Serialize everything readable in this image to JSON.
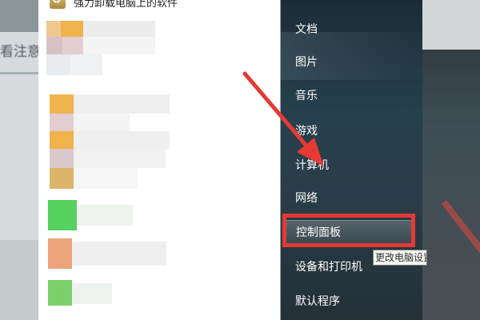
{
  "start_menu": {
    "left_pane": {
      "top_item_label": "强力卸载电脑上的软件"
    },
    "right_pane": {
      "items": [
        {
          "label": "文档"
        },
        {
          "label": "图片"
        },
        {
          "label": "音乐"
        },
        {
          "label": "游戏"
        },
        {
          "label": "计算机"
        },
        {
          "label": "网络"
        },
        {
          "label": "控制面板"
        },
        {
          "label": "设备和打印机"
        },
        {
          "label": "默认程序"
        }
      ],
      "highlighted_item": "控制面板"
    },
    "tooltip_text": "更改电脑设置"
  },
  "background": {
    "left_text": "看注意"
  },
  "annotation": {
    "highlight_color": "#e53a34",
    "arrow_color": "#e53a34"
  }
}
